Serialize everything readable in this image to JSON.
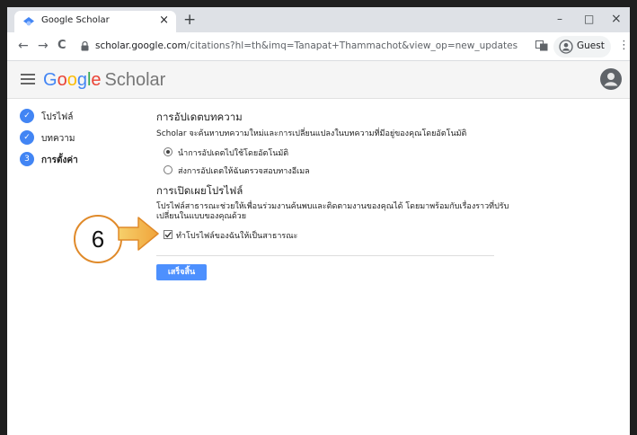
{
  "browser": {
    "tab_title": "Google Scholar",
    "tab_close": "×",
    "new_tab": "+",
    "window_controls": {
      "minimize": "–",
      "maximize": "□",
      "close": "×"
    },
    "nav": {
      "back": "←",
      "forward": "→",
      "reload": "C"
    },
    "url_host": "scholar.google.com",
    "url_path": "/citations?hl=th&imq=Tanapat+Thammachot&view_op=new_updates",
    "profile_label": "Guest",
    "menu": "⋮"
  },
  "header": {
    "logo_letters": [
      "G",
      "o",
      "o",
      "g",
      "l",
      "e"
    ],
    "logo_suffix": "Scholar"
  },
  "sidebar": {
    "steps": [
      {
        "number": "✓",
        "label": "โปรไฟล์"
      },
      {
        "number": "✓",
        "label": "บทความ"
      },
      {
        "number": "3",
        "label": "การตั้งค่า"
      }
    ]
  },
  "main": {
    "updates": {
      "heading": "การอัปเดตบทความ",
      "description": "Scholar จะค้นหาบทความใหม่และการเปลี่ยนแปลงในบทความที่มีอยู่ของคุณโดยอัตโนมัติ",
      "options": [
        {
          "label": "นำการอัปเดตไปใช้โดยอัตโนมัติ",
          "selected": true
        },
        {
          "label": "ส่งการอัปเดตให้ฉันตรวจสอบทางอีเมล",
          "selected": false
        }
      ]
    },
    "visibility": {
      "heading": "การเปิดเผยโปรไฟล์",
      "description_line1": "โปรไฟล์สาธารณะช่วยให้เพื่อนร่วมงานค้นพบและติดตามงานของคุณได้ โดยมาพร้อมกับเรื่องราวที่ปรับ",
      "description_line2": "เปลี่ยนในแบบของคุณด้วย",
      "checkbox_label": "ทำโปรไฟล์ของฉันให้เป็นสาธารณะ",
      "checked": true
    },
    "done_label": "เสร็จสิ้น"
  },
  "annotation": {
    "number": "6",
    "color": "#e08a2a"
  }
}
